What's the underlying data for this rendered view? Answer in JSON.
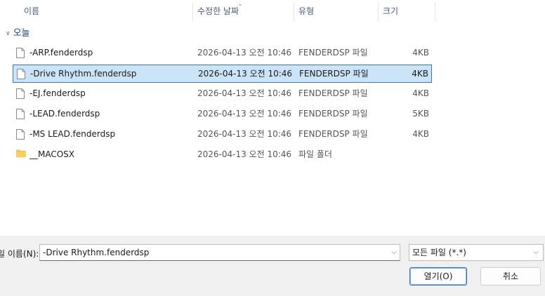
{
  "columns": {
    "name": "이름",
    "date": "수정한 날짜",
    "type": "유형",
    "size": "크기"
  },
  "group": {
    "label": "오늘"
  },
  "files": [
    {
      "name": "-ARP.fenderdsp",
      "date": "2026-04-13 오전 10:46",
      "type": "FENDERDSP 파일",
      "size": "4KB",
      "icon": "file-icon",
      "selected": false
    },
    {
      "name": "-Drive Rhythm.fenderdsp",
      "date": "2026-04-13 오전 10:46",
      "type": "FENDERDSP 파일",
      "size": "4KB",
      "icon": "file-icon",
      "selected": true
    },
    {
      "name": "-EJ.fenderdsp",
      "date": "2026-04-13 오전 10:46",
      "type": "FENDERDSP 파일",
      "size": "4KB",
      "icon": "file-icon",
      "selected": false
    },
    {
      "name": "-LEAD.fenderdsp",
      "date": "2026-04-13 오전 10:46",
      "type": "FENDERDSP 파일",
      "size": "5KB",
      "icon": "file-icon",
      "selected": false
    },
    {
      "name": "-MS LEAD.fenderdsp",
      "date": "2026-04-13 오전 10:46",
      "type": "FENDERDSP 파일",
      "size": "4KB",
      "icon": "file-icon",
      "selected": false
    },
    {
      "name": "__MACOSX",
      "date": "2026-04-13 오전 10:46",
      "type": "파일 폴더",
      "size": "",
      "icon": "folder-icon",
      "selected": false
    }
  ],
  "footer": {
    "filename_label": "일 이름(N):",
    "filename_value": "-Drive Rhythm.fenderdsp",
    "filetype_value": "모든 파일 (*.*)",
    "open_label": "열기(O)",
    "cancel_label": "취소"
  },
  "colors": {
    "accent": "#3a78b5",
    "selection_bg": "#cce4f7",
    "group_text": "#1f3f8f",
    "folder": "#f2c14e"
  }
}
